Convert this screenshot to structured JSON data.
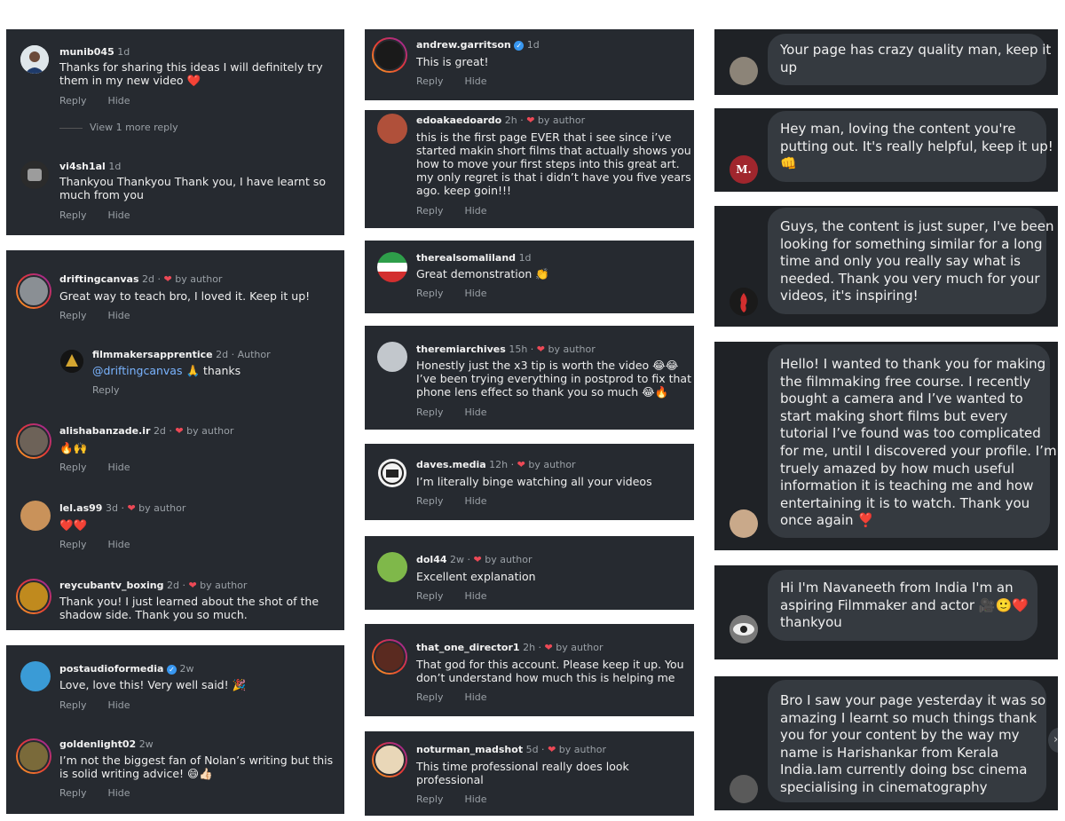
{
  "actions": {
    "reply": "Reply",
    "hide": "Hide",
    "view_more": "View 1 more reply",
    "by_author": "by author"
  },
  "col1": {
    "c1": {
      "user": "munib045",
      "time": "1d",
      "lines": [
        "Thanks for sharing this ideas I will definitely try",
        "them in my new video ❤️"
      ]
    },
    "c2": {
      "user": "vi4sh1al",
      "time": "1d",
      "lines": [
        "Thankyou Thankyou Thank you, I have learnt so",
        "much from you"
      ]
    },
    "c3": {
      "user": "driftingcanvas",
      "time": "2d ·",
      "lines": [
        "Great way to teach bro, I loved it. Keep it up!"
      ]
    },
    "c4": {
      "user": "filmmakersapprentice",
      "time": "2d · Author",
      "mention": "@driftingcanvas",
      "rest": " 🙏 thanks"
    },
    "c5": {
      "user": "alishabanzade.ir",
      "time": "2d ·",
      "lines": [
        "🔥🙌"
      ]
    },
    "c6": {
      "user": "lel.as99",
      "time": "3d ·",
      "lines": [
        "❤️❤️"
      ]
    },
    "c7": {
      "user": "reycubantv_boxing",
      "time": "2d ·",
      "lines": [
        "Thank you! I just learned about the shot of the",
        "shadow side. Thank you so much."
      ]
    },
    "c8": {
      "user": "postaudioformedia",
      "time": "2w",
      "lines": [
        "Love, love this! Very well said! 🎉"
      ]
    },
    "c9": {
      "user": "goldenlight02",
      "time": "2w",
      "lines": [
        "I’m not the biggest fan of Nolan’s writing but this",
        "is solid writing advice! 😄👍🏻"
      ]
    }
  },
  "col2": {
    "c1": {
      "user": "andrew.garritson",
      "time": "1d",
      "lines": [
        "This is great!"
      ]
    },
    "c2": {
      "user": "edoakaedoardo",
      "time": "2h ·",
      "lines": [
        "this is the first page EVER that i see since i’ve",
        "started makin short films that actually shows you",
        "how to move your first steps into this great art.",
        "my only regret is that i didn’t have you five years",
        "ago. keep goin!!!"
      ]
    },
    "c3": {
      "user": "therealsomaliland",
      "time": "1d",
      "lines": [
        "Great demonstration 👏"
      ]
    },
    "c4": {
      "user": "theremiarchives",
      "time": "15h ·",
      "lines": [
        "Honestly just the x3 tip is worth the video 😂😂",
        "I’ve been trying everything in postprod to fix that",
        "phone lens effect so thank you so much 😂🔥"
      ]
    },
    "c5": {
      "user": "daves.media",
      "time": "12h ·",
      "lines": [
        "I’m literally binge watching all your videos"
      ]
    },
    "c6": {
      "user": "dol44",
      "time": "2w ·",
      "lines": [
        "Excellent explanation"
      ]
    },
    "c7": {
      "user": "that_one_director1",
      "time": "2h ·",
      "lines": [
        "That god for this account. Please keep it up. You",
        "don’t understand how much this is helping me"
      ]
    },
    "c8": {
      "user": "noturman_madshot",
      "time": "5d ·",
      "lines": [
        "This time professional really does look",
        "professional"
      ]
    }
  },
  "col3": {
    "b1": [
      "Your page has crazy quality man, keep it",
      "up"
    ],
    "b2": [
      "Hey man, loving the content you're",
      "putting out. It's really helpful, keep it up!",
      "👊"
    ],
    "b3": [
      "Guys, the content is just super, I've been",
      "looking for something similar for a long",
      "time and only you really say what is",
      "needed. Thank you very much for your",
      "videos, it's inspiring!"
    ],
    "b4": [
      "Hello! I wanted to thank you for making",
      "the filmmaking free course. I recently",
      "bought a camera and I’ve wanted to",
      "start making short films but every",
      "tutorial I’ve found was too complicated",
      "for me, until I discovered your profile. I’m",
      "truely amazed by how much useful",
      "information it is teaching me and how",
      "entertaining it is to watch. Thank you",
      "once again ❣️"
    ],
    "b5": [
      "Hi I'm Navaneeth from India I'm an",
      "aspiring Filmmaker and actor 🎥🙂❤️",
      "thankyou"
    ],
    "b6": [
      "Bro I saw your page yesterday it was so",
      "amazing I learnt so much things thank",
      "you for your content by the way my",
      "name is Harishankar from Kerala",
      "India.Iam currently doing bsc cinema",
      "specialising in cinematography"
    ],
    "m_initial": "M."
  },
  "colors": {
    "card": "#262a30",
    "bubble": "#353a40",
    "heart": "#ed4956",
    "verified": "#3897f0",
    "mention": "#7ab4ff"
  }
}
